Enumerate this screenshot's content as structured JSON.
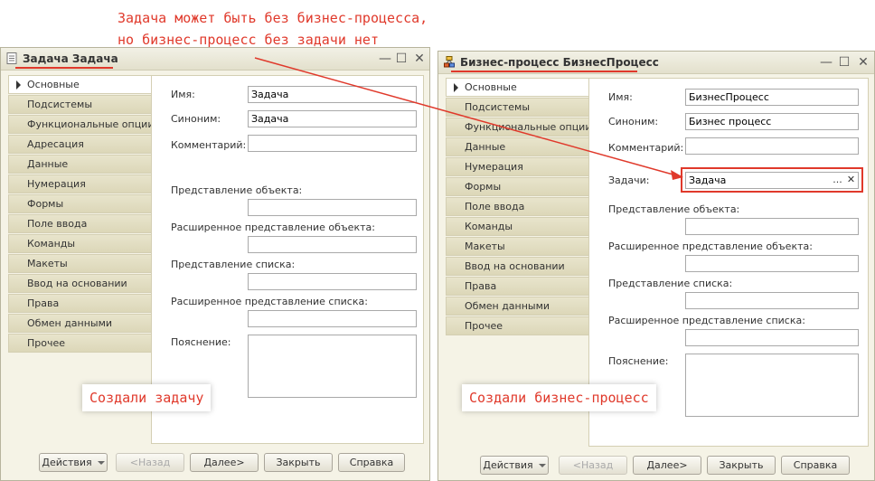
{
  "annotations": {
    "top_line1": "Задача может быть без бизнес-процесса,",
    "top_line2": "но бизнес-процесс без задачи нет",
    "left_caption": "Создали задачу",
    "right_caption": "Создали бизнес-процесс"
  },
  "colors": {
    "accent": "#e0392b"
  },
  "window_controls": {
    "minimize": "—",
    "maximize": "☐",
    "close": "✕"
  },
  "task_window": {
    "title": "Задача Задача",
    "icon": "document-icon",
    "tabs": [
      "Основные",
      "Подсистемы",
      "Функциональные опции",
      "Адресация",
      "Данные",
      "Нумерация",
      "Формы",
      "Поле ввода",
      "Команды",
      "Макеты",
      "Ввод на основании",
      "Права",
      "Обмен данными",
      "Прочее"
    ],
    "active_tab": "Основные",
    "fields": {
      "name_label": "Имя:",
      "name_value": "Задача",
      "synonym_label": "Синоним:",
      "synonym_value": "Задача",
      "comment_label": "Комментарий:",
      "comment_value": "",
      "obj_repr_label": "Представление объекта:",
      "obj_repr_value": "",
      "ext_obj_repr_label": "Расширенное представление объекта:",
      "ext_obj_repr_value": "",
      "list_repr_label": "Представление списка:",
      "list_repr_value": "",
      "ext_list_repr_label": "Расширенное представление списка:",
      "ext_list_repr_value": "",
      "explanation_label": "Пояснение:",
      "explanation_value": ""
    },
    "buttons": {
      "actions": "Действия",
      "back": "<Назад",
      "next": "Далее>",
      "close": "Закрыть",
      "help": "Справка"
    }
  },
  "bp_window": {
    "title": "Бизнес-процесс БизнесПроцесс",
    "icon": "business-process-icon",
    "tabs": [
      "Основные",
      "Подсистемы",
      "Функциональные опции",
      "Данные",
      "Нумерация",
      "Формы",
      "Поле ввода",
      "Команды",
      "Макеты",
      "Ввод на основании",
      "Права",
      "Обмен данными",
      "Прочее"
    ],
    "active_tab": "Основные",
    "fields": {
      "name_label": "Имя:",
      "name_value": "БизнесПроцесс",
      "synonym_label": "Синоним:",
      "synonym_value": "Бизнес процесс",
      "comment_label": "Комментарий:",
      "comment_value": "",
      "task_label": "Задачи:",
      "task_value": "Задача",
      "obj_repr_label": "Представление объекта:",
      "obj_repr_value": "",
      "ext_obj_repr_label": "Расширенное представление объекта:",
      "ext_obj_repr_value": "",
      "list_repr_label": "Представление списка:",
      "list_repr_value": "",
      "ext_list_repr_label": "Расширенное представление списка:",
      "ext_list_repr_value": "",
      "explanation_label": "Пояснение:",
      "explanation_value": ""
    },
    "task_select_btn": "...",
    "task_clear_btn": "✕",
    "buttons": {
      "actions": "Действия",
      "back": "<Назад",
      "next": "Далее>",
      "close": "Закрыть",
      "help": "Справка"
    }
  }
}
